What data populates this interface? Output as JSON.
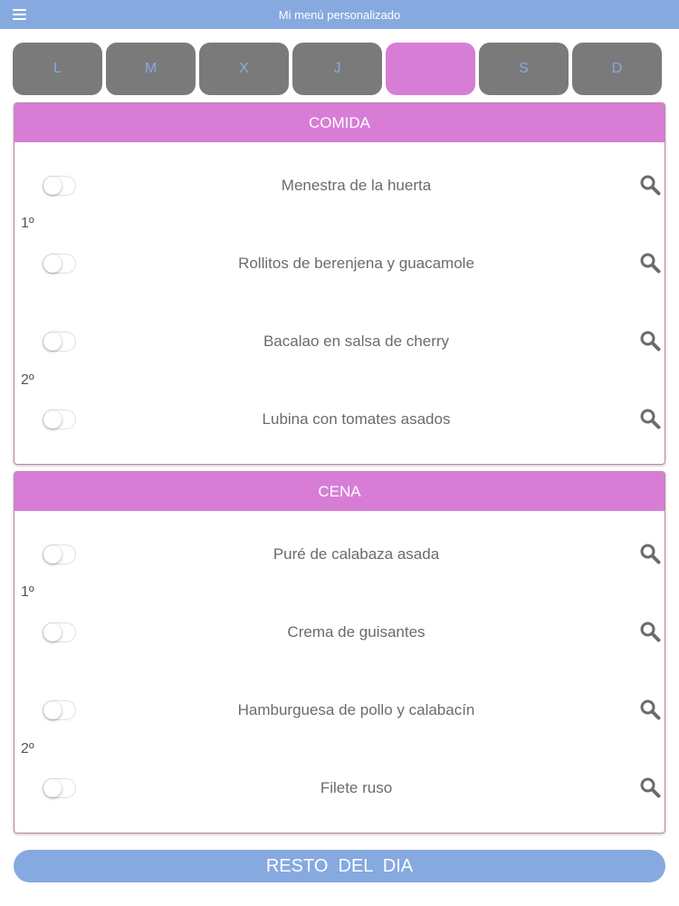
{
  "app": {
    "title": "Mi menú personalizado"
  },
  "colors": {
    "accent_blue": "#86a9e0",
    "meal_header": "#d77dd6",
    "day_inactive": "#7a7a7a",
    "day_active": "#d77dd6"
  },
  "days": [
    {
      "label": "L",
      "active": false
    },
    {
      "label": "M",
      "active": false
    },
    {
      "label": "X",
      "active": false
    },
    {
      "label": "J",
      "active": false
    },
    {
      "label": "V",
      "active": true
    },
    {
      "label": "S",
      "active": false
    },
    {
      "label": "D",
      "active": false
    }
  ],
  "meals": [
    {
      "title": "COMIDA",
      "courses": [
        {
          "label": "1º",
          "dishes": [
            {
              "name": "Menestra de la huerta",
              "selected": false
            },
            {
              "name": "Rollitos de berenjena y guacamole",
              "selected": false
            }
          ]
        },
        {
          "label": "2º",
          "dishes": [
            {
              "name": "Bacalao en salsa de cherry",
              "selected": false
            },
            {
              "name": "Lubina con tomates asados",
              "selected": false
            }
          ]
        }
      ]
    },
    {
      "title": "CENA",
      "courses": [
        {
          "label": "1º",
          "dishes": [
            {
              "name": "Puré de calabaza asada",
              "selected": false
            },
            {
              "name": "Crema de guisantes",
              "selected": false
            }
          ]
        },
        {
          "label": "2º",
          "dishes": [
            {
              "name": "Hamburguesa de pollo y calabacín",
              "selected": false
            },
            {
              "name": "Filete ruso",
              "selected": false
            }
          ]
        }
      ]
    }
  ],
  "footer": {
    "rest_button": "RESTO  DEL  DIA"
  },
  "icons": {
    "menu": "hamburger-menu-icon",
    "search": "search-icon"
  }
}
